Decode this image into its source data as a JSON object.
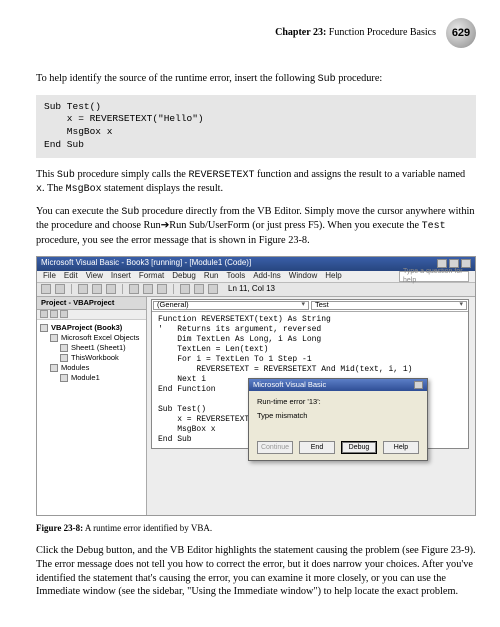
{
  "header": {
    "chapter_prefix": "Chapter 23:",
    "chapter_title": " Function Procedure Basics",
    "page_number": "629"
  },
  "para1_a": "To help identify the source of the runtime error, insert the following ",
  "para1_code": "Sub",
  "para1_b": " procedure:",
  "code_block": "Sub Test()\n    x = REVERSETEXT(\"Hello\")\n    MsgBox x\nEnd Sub",
  "para2_a": "This ",
  "para2_code1": "Sub",
  "para2_b": " procedure simply calls the ",
  "para2_code2": "REVERSETEXT",
  "para2_c": " function and assigns the result to a variable named ",
  "para2_code3": "x",
  "para2_d": ". The ",
  "para2_code4": "MsgBox",
  "para2_e": " statement displays the result.",
  "para3_a": "You can execute the ",
  "para3_code1": "Sub",
  "para3_b": " procedure directly from the VB Editor. Simply move the cursor anywhere within the procedure and choose Run➔Run Sub/UserForm (or just press F5). When you execute the ",
  "para3_code2": "Test",
  "para3_c": " procedure, you see the error message that is shown in Figure 23-8.",
  "ide": {
    "title": "Microsoft Visual Basic - Book3 [running] - [Module1 (Code)]",
    "menus": [
      "File",
      "Edit",
      "View",
      "Insert",
      "Format",
      "Debug",
      "Run",
      "Tools",
      "Add-Ins",
      "Window",
      "Help"
    ],
    "help_placeholder": "Type a question for help",
    "toolbar_status": "Ln 11, Col 13",
    "project_title": "Project - VBAProject",
    "tree": {
      "root": "VBAProject (Book3)",
      "folder1": "Microsoft Excel Objects",
      "item1": "Sheet1 (Sheet1)",
      "item2": "ThisWorkbook",
      "folder2": "Modules",
      "item3": "Module1"
    },
    "combo_left": "(General)",
    "combo_right": "Test",
    "code": "Function REVERSETEXT(text) As String\n'   Returns its argument, reversed\n    Dim TextLen As Long, i As Long\n    TextLen = Len(text)\n    For i = TextLen To 1 Step -1\n        REVERSETEXT = REVERSETEXT And Mid(text, i, 1)\n    Next i\nEnd Function\n\nSub Test()\n    x = REVERSETEXT(\"Hello\")\n    MsgBox x\nEnd Sub",
    "dialog": {
      "title": "Microsoft Visual Basic",
      "line1": "Run-time error '13':",
      "line2": "Type mismatch",
      "btn_continue": "Continue",
      "btn_end": "End",
      "btn_debug": "Debug",
      "btn_help": "Help"
    }
  },
  "figure_caption_label": "Figure 23-8:",
  "figure_caption_text": " A runtime error identified by VBA.",
  "para4": "Click the Debug button, and the VB Editor highlights the statement causing the problem (see Figure 23-9). The error message does not tell you how to correct the error, but it does narrow your choices. After you've identified the statement that's causing the error, you can examine it more closely, or you can use the Immediate window (see the sidebar, \"Using the Immediate window\") to help locate the exact problem."
}
